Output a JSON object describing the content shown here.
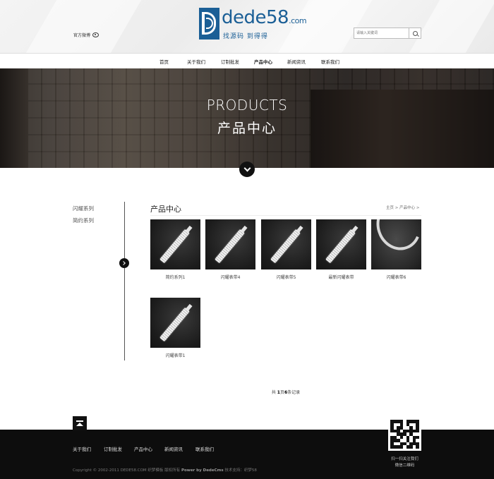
{
  "header": {
    "weibo_label": "官方微博",
    "logo_main": "dede58",
    "logo_suffix": ".com",
    "logo_tagline": "找源码 到得得",
    "search_placeholder": "请输入关键词"
  },
  "nav": {
    "items": [
      {
        "label": "首页"
      },
      {
        "label": "关于我们"
      },
      {
        "label": "订制批发"
      },
      {
        "label": "产品中心",
        "active": true
      },
      {
        "label": "新闻资讯"
      },
      {
        "label": "联系我们"
      }
    ]
  },
  "banner": {
    "title_en": "PRODUCTS",
    "title_cn": "产品中心"
  },
  "sidebar": {
    "items": [
      {
        "label": "闪耀系列"
      },
      {
        "label": "简约系列"
      }
    ]
  },
  "main": {
    "title": "产品中心",
    "breadcrumb": "主页 > 产品中心 >",
    "products": [
      {
        "name": "简约系列1",
        "image": "watch-strap"
      },
      {
        "name": "闪耀表带4",
        "image": "watch-strap"
      },
      {
        "name": "闪耀表带5",
        "image": "watch-strap"
      },
      {
        "name": "最新闪耀表带",
        "image": "watch-strap"
      },
      {
        "name": "闪耀表带6",
        "image": "bangle"
      },
      {
        "name": "闪耀表带1",
        "image": "watch-strap"
      }
    ],
    "pager": {
      "prefix": "共 ",
      "pages": "1",
      "pages_unit": "页",
      "records": "6",
      "records_unit": "条记录"
    }
  },
  "footer": {
    "links": [
      {
        "label": "关于我们"
      },
      {
        "label": "订制批发"
      },
      {
        "label": "产品中心"
      },
      {
        "label": "新闻资讯"
      },
      {
        "label": "联系我们"
      }
    ],
    "copyright_pre": "Copyright © 2002-2011 DEDE58.COM 织梦模板 版权所有 ",
    "copyright_power": "Power by DedeCms",
    "copyright_post": " 技术支持：织梦58",
    "qr_line1": "扫一扫关注我们",
    "qr_line2": "微信二维码"
  },
  "colors": {
    "brand": "#1b5f96",
    "footer_bg": "#0d0d0d",
    "accent_dark": "#111111"
  }
}
